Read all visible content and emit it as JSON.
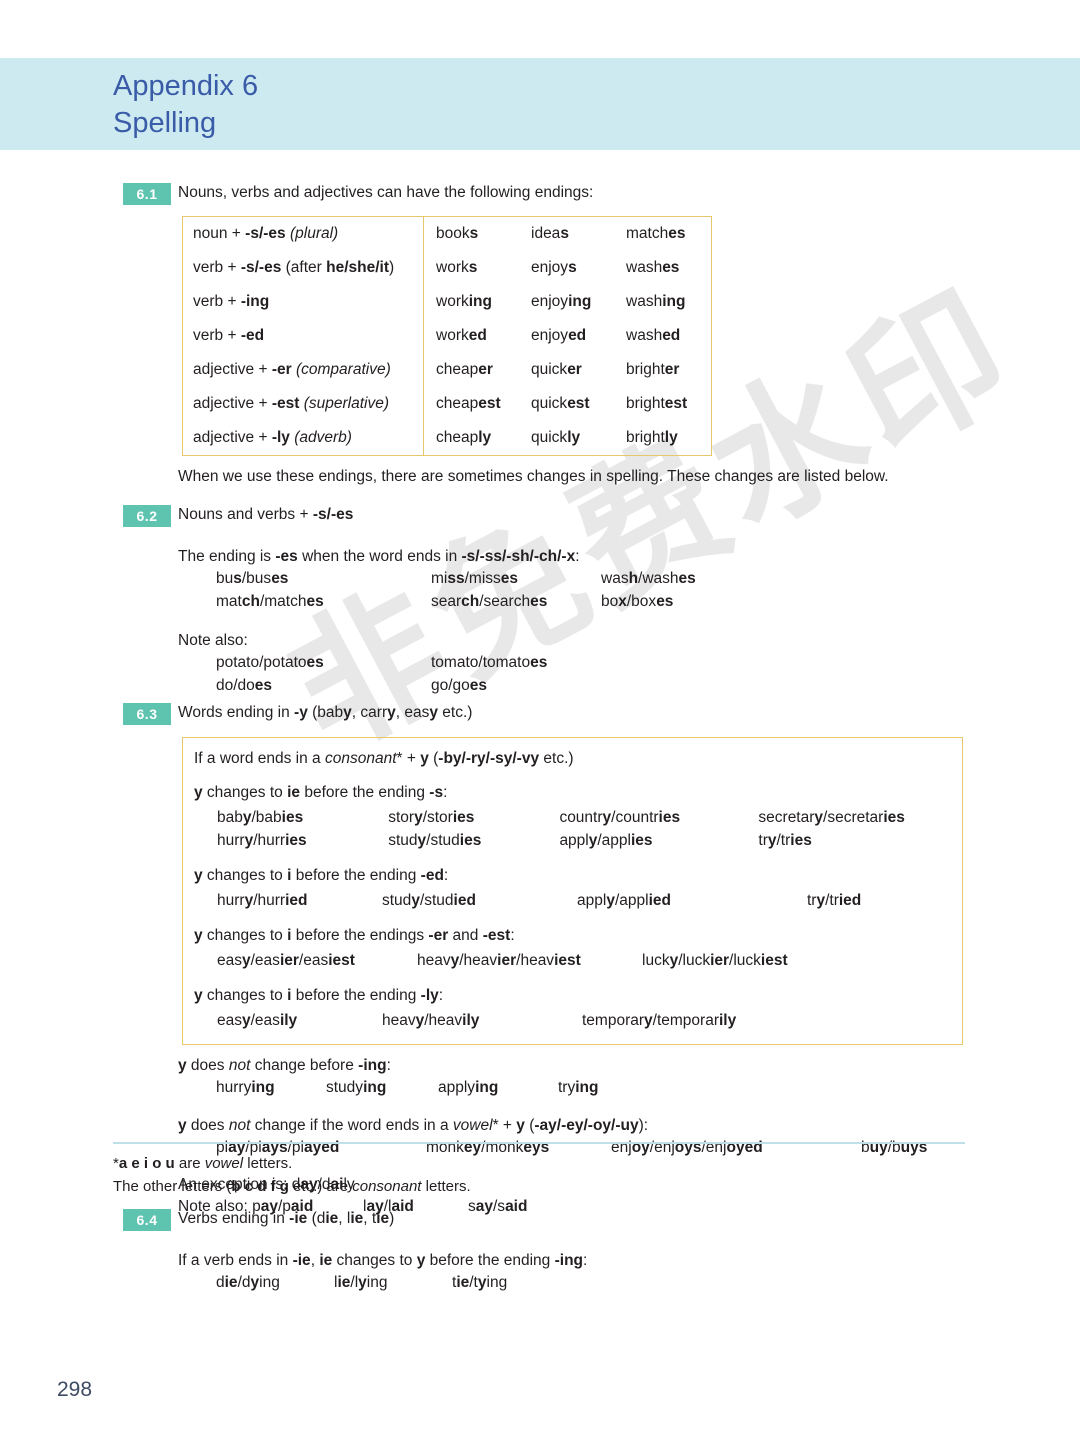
{
  "header": {
    "appendix": "Appendix 6",
    "title": "Spelling",
    "band_color": "#cdeaf0",
    "title_color": "#3a5ca8"
  },
  "watermark": {
    "text": "非免费水印"
  },
  "badge_color": "#5ec4b0",
  "box_border_color": "#e8c76a",
  "rule_color": "#bfe0e8",
  "sections": {
    "s61": {
      "number": "6.1",
      "intro": "Nouns, verbs and adjectives can have the following endings:",
      "table": {
        "rows": [
          {
            "rule_html": "noun + <b>-s/-es</b> <i>(plural)</i>",
            "examples": [
              "book<b>s</b>",
              "idea<b>s</b>",
              "match<b>es</b>"
            ]
          },
          {
            "rule_html": "verb + <b>-s/-es</b> (after <b>he/she/it</b>)",
            "examples": [
              "work<b>s</b>",
              "enjoy<b>s</b>",
              "wash<b>es</b>"
            ]
          },
          {
            "rule_html": "verb + <b>-ing</b>",
            "examples": [
              "work<b>ing</b>",
              "enjoy<b>ing</b>",
              "wash<b>ing</b>"
            ]
          },
          {
            "rule_html": "verb + <b>-ed</b>",
            "examples": [
              "work<b>ed</b>",
              "enjoy<b>ed</b>",
              "wash<b>ed</b>"
            ]
          },
          {
            "rule_html": "adjective + <b>-er</b> <i>(comparative)</i>",
            "examples": [
              "cheap<b>er</b>",
              "quick<b>er</b>",
              "bright<b>er</b>"
            ]
          },
          {
            "rule_html": "adjective + <b>-est</b> <i>(superlative)</i>",
            "examples": [
              "cheap<b>est</b>",
              "quick<b>est</b>",
              "bright<b>est</b>"
            ]
          },
          {
            "rule_html": "adjective + <b>-ly</b> <i>(adverb)</i>",
            "examples": [
              "cheap<b>ly</b>",
              "quick<b>ly</b>",
              "bright<b>ly</b>"
            ]
          }
        ]
      },
      "after_table": "When we use these endings, there are sometimes changes in spelling.  These changes are listed below."
    },
    "s62": {
      "number": "6.2",
      "heading_html": "Nouns and verbs + <b>-s/-es</b>",
      "rule_html": "The ending is <b>-es</b> when the word ends in <b>-s/-ss/-sh/-ch/-x</b>:",
      "examples_row1": [
        "bu<b>s</b>/bus<b>es</b>",
        "mi<b>ss</b>/miss<b>es</b>",
        "was<b>h</b>/wash<b>es</b>"
      ],
      "examples_row2": [
        "mat<b>ch</b>/match<b>es</b>",
        "sear<b>ch</b>/search<b>es</b>",
        "bo<b>x</b>/box<b>es</b>"
      ],
      "note_label": "Note also:",
      "note_row1": [
        "potato/potato<b>es</b>",
        "tomato/tomato<b>es</b>"
      ],
      "note_row2": [
        "do/do<b>es</b>",
        "go/go<b>es</b>"
      ]
    },
    "s63": {
      "number": "6.3",
      "heading_html": "Words ending in <b>-y</b> (bab<b>y</b>, carr<b>y</b>, eas<b>y</b> etc.)",
      "box": {
        "intro_html": "If a word ends in a <i>consonant</i>* + <b>y</b> (<b>-by/-ry/-sy/-vy</b> etc.)",
        "blocks": [
          {
            "rule_html": "<b>y</b> changes to <b>ie</b> before the ending <b>-s</b>:",
            "rows": [
              [
                "bab<b>y</b>/bab<b>ies</b>",
                "stor<b>y</b>/stor<b>ies</b>",
                "countr<b>y</b>/countr<b>ies</b>",
                "secretar<b>y</b>/secretar<b>ies</b>"
              ],
              [
                "hurr<b>y</b>/hurr<b>ies</b>",
                "stud<b>y</b>/stud<b>ies</b>",
                "appl<b>y</b>/appl<b>ies</b>",
                "tr<b>y</b>/tr<b>ies</b>"
              ]
            ]
          },
          {
            "rule_html": "<b>y</b> changes to <b>i</b> before the ending <b>-ed</b>:",
            "rows": [
              [
                "hurr<b>y</b>/hurr<b>ied</b>",
                "stud<b>y</b>/stud<b>ied</b>",
                "appl<b>y</b>/appl<b>ied</b>",
                "tr<b>y</b>/tr<b>ied</b>"
              ]
            ]
          },
          {
            "rule_html": "<b>y</b> changes to <b>i</b> before the endings <b>-er</b> and <b>-est</b>:",
            "rows": [
              [
                "eas<b>y</b>/eas<b>ier</b>/eas<b>iest</b>",
                "heav<b>y</b>/heav<b>ier</b>/heav<b>iest</b>",
                "luck<b>y</b>/luck<b>ier</b>/luck<b>iest</b>"
              ]
            ]
          },
          {
            "rule_html": "<b>y</b> changes to <b>i</b> before the ending <b>-ly</b>:",
            "rows": [
              [
                "eas<b>y</b>/eas<b>ily</b>",
                "heav<b>y</b>/heav<b>ily</b>",
                "temporar<b>y</b>/temporar<b>ily</b>"
              ]
            ]
          }
        ]
      },
      "after_box": [
        {
          "rule_html": "<b>y</b> does <i>not</i> change before <b>-ing</b>:",
          "rows": [
            [
              "hurry<b>ing</b>",
              "study<b>ing</b>",
              "apply<b>ing</b>",
              "try<b>ing</b>"
            ]
          ]
        },
        {
          "rule_html": "<b>y</b> does <i>not</i> change if the word ends in a <i>vowel</i>* + <b>y</b> (<b>-ay/-ey/-oy/-uy</b>):",
          "rows": [
            [
              "pl<b>ay</b>/pl<b>ays</b>/pl<b>ayed</b>",
              "monk<b>ey</b>/monk<b>eys</b>",
              "enj<b>oy</b>/enj<b>oys</b>/enj<b>oyed</b>",
              "b<b>uy</b>/b<b>uys</b>"
            ]
          ]
        }
      ],
      "exception_html": "An exception is: d<b>ay</b>/d<b>ai</b>ly",
      "note_also_html": "Note also: p<b>ay</b>/p<b>aid</b>",
      "note_also_more": [
        "l<b>ay</b>/l<b>aid</b>",
        "s<b>ay</b>/s<b>aid</b>"
      ]
    },
    "s64": {
      "number": "6.4",
      "heading_html": "Verbs ending in <b>-ie</b> (d<b>ie</b>, l<b>ie</b>, t<b>ie</b>)",
      "rule_html": "If a verb ends in <b>-ie</b>, <b>ie</b> changes to <b>y</b> before the ending <b>-ing</b>:",
      "examples": [
        "d<b>ie</b>/d<b>y</b>ing",
        "l<b>ie</b>/l<b>y</b>ing",
        "t<b>ie</b>/t<b>y</b>ing"
      ]
    }
  },
  "footnote": {
    "line1_html": "*<b>a  e  i  o  u</b> are <i>vowel</i> letters.",
    "line2_html": "The other letters (<b>b  c  d  f  g</b> etc.) are <i>consonant</i> letters."
  },
  "page_number": "298"
}
